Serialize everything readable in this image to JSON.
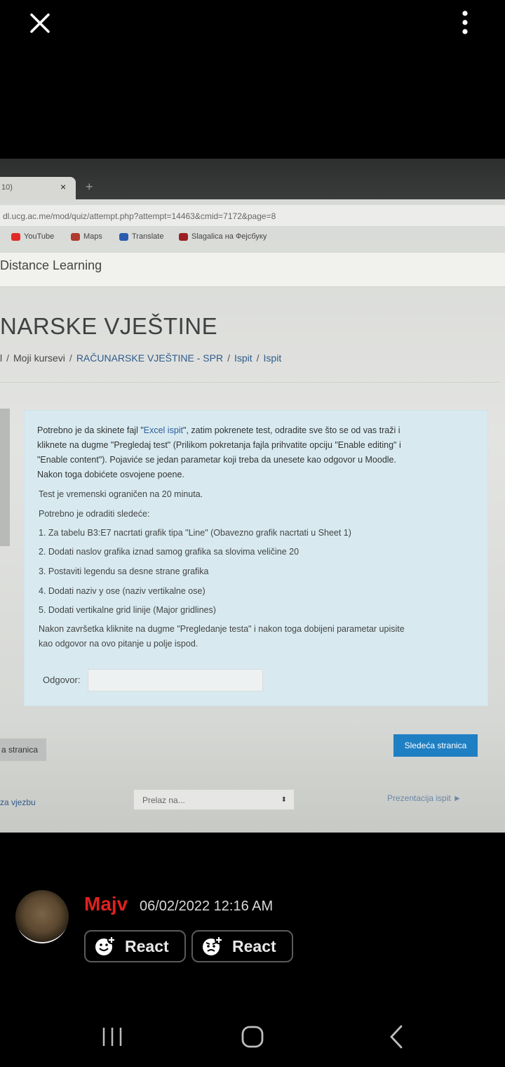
{
  "browser": {
    "tab_title": "10)",
    "tab_close": "×",
    "new_tab": "+",
    "url": "dl.ucg.ac.me/mod/quiz/attempt.php?attempt=14463&cmid=7172&page=8",
    "bookmarks": [
      {
        "label": "YouTube",
        "color": "#e12a26"
      },
      {
        "label": "Maps",
        "color": "#b03a2e"
      },
      {
        "label": "Translate",
        "color": "#2a5db0"
      },
      {
        "label": "Slagalica на Фејсбуку",
        "color": "#9b1f22"
      }
    ]
  },
  "page": {
    "site_name": "Distance Learning",
    "course_title": "NARSKE VJEŠTINE",
    "breadcrumb": [
      "l",
      "Moji kursevi",
      "RAČUNARSKE VJEŠTINE - SPR",
      "Ispit",
      "Ispit"
    ],
    "question": {
      "intro_before_link": "Potrebno je da skinete fajl \"",
      "intro_link": "Excel ispit",
      "intro_after_link": "\", zatim pokrenete test, odradite sve što se od vas traži i",
      "intro_line2": "kliknete na dugme \"Pregledaj test\" (Prilikom pokretanja fajla prihvatite opciju \"Enable editing\" i",
      "intro_line3": "\"Enable content\").  Pojaviće se jedan parametar koji treba da unesete kao odgovor u Moodle.",
      "intro_line4": "Nakon toga dobićete osvojene poene.",
      "time_limit": "Test je vremenski ograničen na 20 minuta.",
      "tasks_heading": "Potrebno je odraditi sledeće:",
      "tasks": [
        "1. Za tabelu B3:E7 nacrtati grafik tipa \"Line\" (Obavezno grafik nacrtati u Sheet 1)",
        "2. Dodati naslov grafika iznad samog grafika sa slovima veličine 20",
        "3. Postaviti legendu sa desne strane grafika",
        "4. Dodati naziv y ose (naziv vertikalne ose)",
        "5. Dodati vertikalne grid linije (Major gridlines)"
      ],
      "outro_line1": "Nakon završetka kliknite na dugme \"Pregledanje testa\" i nakon toga dobijeni parametar upisite",
      "outro_line2": "kao odgovor na ovo pitanje u polje ispod.",
      "answer_label": "Odgovor:",
      "answer_value": ""
    },
    "prev_button": "a stranica",
    "next_button": "Sledeća stranica",
    "prev_activity_link": "za vjezbu",
    "jump_placeholder": "Prelaz na...",
    "jump_arrow": "⬍",
    "next_activity_link": "Prezentacija ispit ►"
  },
  "message": {
    "username": "Majv",
    "timestamp": "06/02/2022 12:16 AM",
    "react_buttons": [
      "React",
      "React"
    ]
  },
  "colors": {
    "username": "#e0211f",
    "next_button": "#1e7fc3",
    "question_bg": "#d8eaf0"
  }
}
